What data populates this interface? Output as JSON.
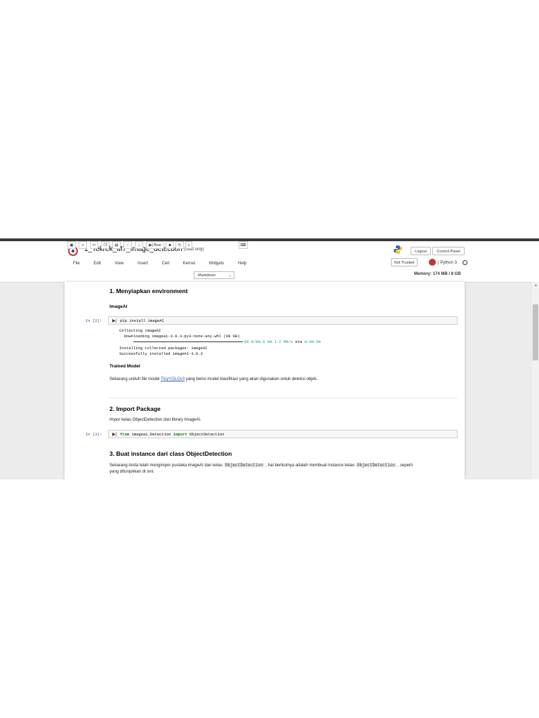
{
  "header": {
    "notebook_title": "1_Tekrek_M7_Image_detection",
    "read_only": "(read only)",
    "logout_label": "Logout",
    "control_panel_label": "Control Panel",
    "trusted_label": "Not Trusted",
    "kernel_name": "| Python 3"
  },
  "menu": [
    "File",
    "Edit",
    "View",
    "Insert",
    "Cell",
    "Kernel",
    "Widgets",
    "Help"
  ],
  "toolbar": {
    "run_label": "Run",
    "cell_type": "Markdown",
    "memory": "Memory: 174 MB / 8 GB"
  },
  "notebook": {
    "section1_title": "1. Menyiapkan environment",
    "imageai_heading": "ImageAI",
    "cell1_prompt": "In [2]:",
    "cell1_code": "pip install imageAI",
    "out_line1": "Collecting imageAI",
    "out_line2": "  Downloading imageai-3.0.3-py3-none-any.whl (69 kB)",
    "out_line3a": "69.0/69.0 kB",
    "out_line3b": "1.2 MB/s",
    "out_line3c": "eta",
    "out_line3d": "0:00:00",
    "out_line4": "Installing collected packages: imageAI",
    "out_line5": "Successfully installed imageAI-3.0.3",
    "trained_heading": "Trained Model",
    "trained_text_pre": "Sekarang unduh file model ",
    "trained_link": "TinyYOLOv3",
    "trained_text_post": " yang berisi model klasifikasi yang akan digunakan untuk deteksi objek.",
    "section2_title": "2. Import Package",
    "import_text": "Impor kelas ObjectDetection dari library ImageAI.",
    "cell2_prompt": "In [3]:",
    "cell2_kw_from": "from",
    "cell2_module": " imageai.Detection ",
    "cell2_kw_import": "import",
    "cell2_name": " ObjectDetection",
    "section3_title": "3. Buat instance dari class ObjectDetection",
    "s3_text_a": "Sekarang Anda telah mengimpor pustaka imageAI dan kelas ",
    "s3_code1": "ObjectDetection",
    "s3_text_b": " , hal berikutnya adalah membuat instance kelas ",
    "s3_code2": "ObjectDetection",
    "s3_text_c": " , seperti",
    "s3_text_d": "yang ditunjukkan di sini:"
  },
  "colors": {
    "kernel_indicator": "#c0392b",
    "keyword": "#008000",
    "progress_text": "#1a8f8f",
    "link": "#2a5db0"
  }
}
